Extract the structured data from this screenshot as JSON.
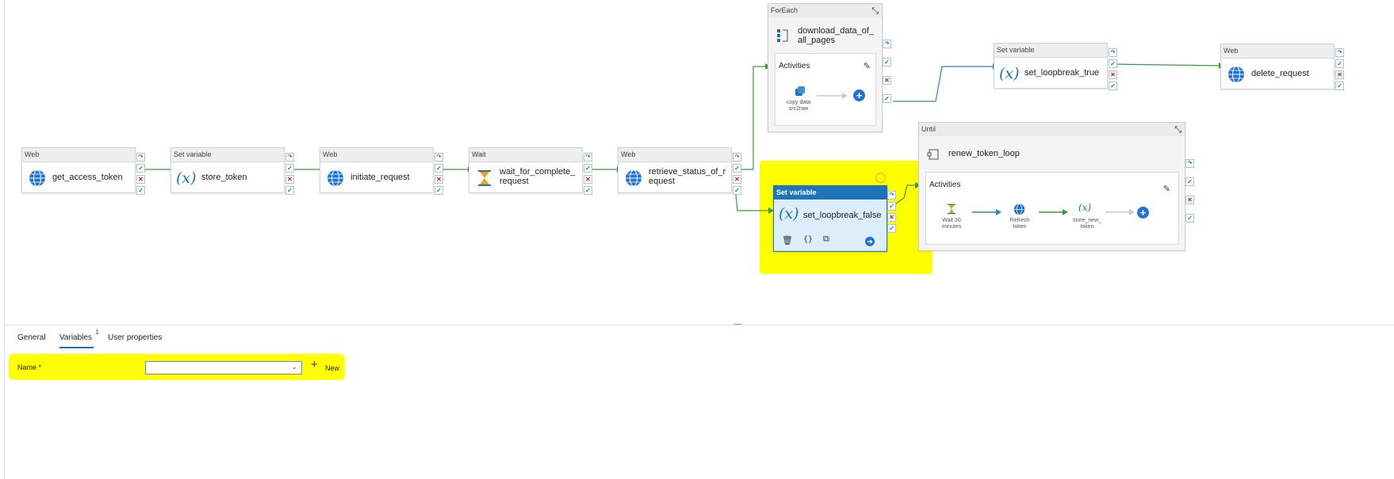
{
  "canvas": {
    "pipeline": [
      {
        "type": "Web",
        "name": "get_access_token",
        "icon": "globe-icon"
      },
      {
        "type": "Set variable",
        "name": "store_token",
        "icon": "variable-icon"
      },
      {
        "type": "Web",
        "name": "initiate_request",
        "icon": "globe-icon"
      },
      {
        "type": "Wait",
        "name": "wait_for_complete_\nrequest",
        "icon": "hourglass-icon"
      },
      {
        "type": "Web",
        "name": "retrieve_status_of_r\nequest",
        "icon": "globe-icon"
      }
    ],
    "foreach": {
      "type": "ForEach",
      "name": "download_data_of_\nall_pages",
      "activities_label": "Activities",
      "inner_activity": "copy data\nsrc2raw"
    },
    "set_true": {
      "type": "Set variable",
      "name": "set_loopbreak_true"
    },
    "delete": {
      "type": "Web",
      "name": "delete_request"
    },
    "selected": {
      "type": "Set variable",
      "name": "set_loopbreak_false"
    },
    "until": {
      "type": "Until",
      "name": "renew_token_loop",
      "activities_label": "Activities",
      "inner": [
        {
          "label": "Wait 30\nminutes"
        },
        {
          "label": "Refresh\ntoken"
        },
        {
          "label": "store_new_\ntoken"
        }
      ]
    }
  },
  "panel": {
    "tabs": [
      {
        "label": "General"
      },
      {
        "label": "Variables",
        "badge": "1"
      },
      {
        "label": "User properties"
      }
    ],
    "name_label": "Name *",
    "name_value": "",
    "new_label": "New"
  }
}
